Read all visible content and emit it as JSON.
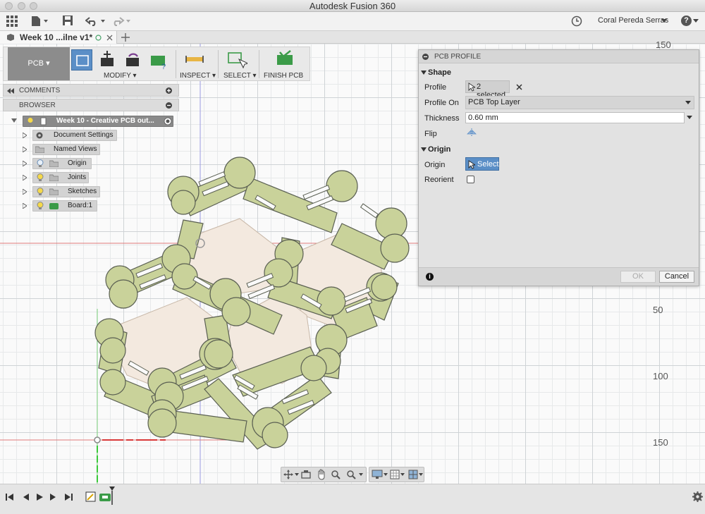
{
  "app": {
    "title": "Autodesk Fusion 360"
  },
  "topbar": {
    "user_name": "Coral Pereda Serras",
    "help_label": "?"
  },
  "tabs": [
    {
      "label": "Week 10 ...ilne v1*"
    }
  ],
  "ribbon": {
    "workspace": "PCB",
    "groups": [
      "MODIFY",
      "INSPECT",
      "SELECT",
      "FINISH PCB"
    ]
  },
  "panels": {
    "comments": "COMMENTS",
    "browser": "BROWSER"
  },
  "browser": {
    "root": "Week 10 - Creative PCB out...",
    "items": [
      "Document Settings",
      "Named Views",
      "Origin",
      "Joints",
      "Sketches",
      "Board:1"
    ]
  },
  "dialog": {
    "title": "PCB PROFILE",
    "shape_section": "Shape",
    "profile_label": "Profile",
    "profile_value": "2 selected",
    "profile_on_label": "Profile On",
    "profile_on_value": "PCB Top Layer",
    "thickness_label": "Thickness",
    "thickness_value": "0.60 mm",
    "flip_label": "Flip",
    "origin_section": "Origin",
    "origin_label": "Origin",
    "origin_button": "Select",
    "reorient_label": "Reorient",
    "ok": "OK",
    "cancel": "Cancel"
  },
  "ruler": [
    "150",
    "50",
    "100",
    "150"
  ],
  "colors": {
    "board": "#c9d29a",
    "board_stroke": "#5a5f52",
    "hex_fill": "#f3e9df",
    "accent": "#5b8fc7"
  }
}
